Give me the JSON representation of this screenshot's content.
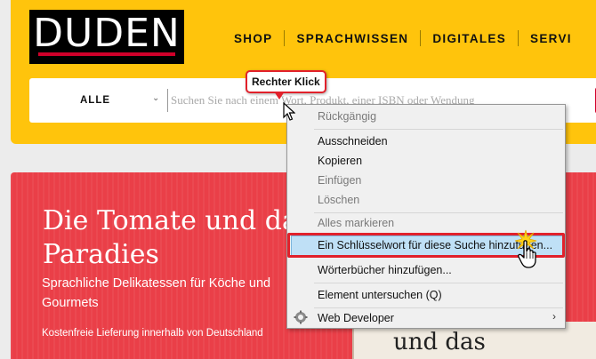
{
  "header": {
    "logo_text": "DUDEN",
    "nav": [
      "SHOP",
      "SPRACHWISSEN",
      "DIGITALES",
      "SERVI"
    ],
    "search": {
      "scope": "ALLE",
      "placeholder": "Suchen Sie nach einem Wort, Produkt, einer ISBN oder Wendung"
    }
  },
  "promo": {
    "title": "Die Tomate und das Paradies",
    "subtitle": "Sprachliche Delikatessen für Köche und Gourmets",
    "note": "Kostenfreie Lieferung innerhalb von Deutschland",
    "book_text": "und das"
  },
  "callout": {
    "text": "Rechter Klick"
  },
  "context_menu": {
    "undo": "Rückgängig",
    "cut": "Ausschneiden",
    "copy": "Kopieren",
    "paste": "Einfügen",
    "delete": "Löschen",
    "select_all": "Alles markieren",
    "add_keyword": "Ein Schlüsselwort für diese Suche hinzufügen...",
    "add_dictionaries": "Wörterbücher hinzufügen...",
    "inspect": "Element untersuchen (Q)",
    "web_developer": "Web Developer"
  },
  "colors": {
    "brand_yellow": "#ffc40c",
    "brand_red": "#d0002a",
    "highlight": "#bfe0f6"
  }
}
